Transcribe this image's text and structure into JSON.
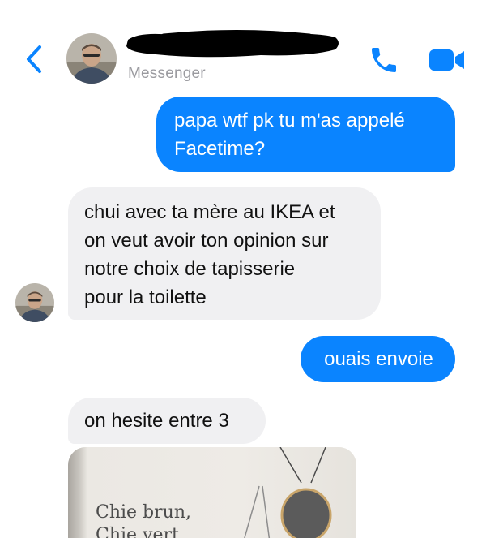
{
  "header": {
    "back_icon": "chevron-left-icon",
    "contact_name": "",
    "subtitle": "Messenger",
    "call_icon": "phone-icon",
    "video_icon": "video-camera-icon"
  },
  "messages": [
    {
      "direction": "outgoing",
      "text": "papa wtf pk tu m'as appelé\nFacetime?"
    },
    {
      "direction": "incoming",
      "text": "chui avec ta mère au IKEA et\non veut avoir ton opinion sur\nnotre choix de tapisserie\npour la toilette"
    },
    {
      "direction": "outgoing",
      "text": "ouais envoie"
    },
    {
      "direction": "incoming",
      "text": "on hesite entre 3"
    }
  ],
  "attachment": {
    "type": "photo",
    "lines": [
      "Chie brun,",
      "Chie vert"
    ]
  },
  "colors": {
    "accent": "#0a84ff",
    "incoming_bubble": "#f0f0f2",
    "subtitle": "#9a9a9f"
  }
}
